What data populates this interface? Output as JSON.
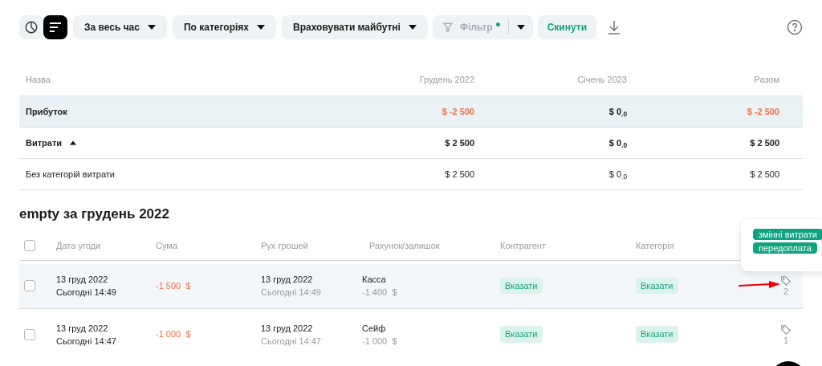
{
  "toolbar": {
    "view_toggles": [
      {
        "kind": "chart",
        "selected": false
      },
      {
        "kind": "list",
        "selected": true
      }
    ],
    "dropdowns": [
      "За весь час",
      "По категоріях",
      "Враховувати майбутні"
    ],
    "filter": {
      "label": "Фільтр",
      "active": true,
      "disabled": true
    },
    "reset": "Скинути"
  },
  "summary": {
    "columns": [
      "Назва",
      "Грудень 2022",
      "Січень 2023",
      "Разом"
    ],
    "rows": [
      {
        "kind": "profit",
        "name": "Прибуток",
        "values": [
          {
            "text": "$ -2 500",
            "negative": true
          },
          {
            "text": "$ 0$_{.0}$",
            "negative": false
          },
          {
            "text": "$ -2 500",
            "negative": true
          }
        ]
      },
      {
        "kind": "group",
        "name": "Витрати",
        "expanded": true,
        "values": [
          {
            "text": "$ 2 500",
            "negative": false
          },
          {
            "text": "$ 0$_{.0}$",
            "negative": false
          },
          {
            "text": "$ 2 500",
            "negative": false
          }
        ]
      },
      {
        "kind": "item",
        "name": "Без категорій витрати",
        "values": [
          {
            "text": "$ 2 500",
            "negative": false
          },
          {
            "text": "$ 0$_{.0}$",
            "negative": false
          },
          {
            "text": "$ 2 500",
            "negative": false
          }
        ]
      }
    ]
  },
  "details": {
    "title": "empty за грудень 2022",
    "columns": [
      "Дата угоди",
      "Сума",
      "Рух грошей",
      "Рахунок/залишок",
      "Контрагент",
      "Категорія"
    ],
    "header_checked": false,
    "rows": [
      {
        "checked": false,
        "highlighted": true,
        "date": "13 груд 2022",
        "date_note": "Сьогодні 14:49",
        "amount": "-1 500  $",
        "flow_date": "13 груд 2022",
        "flow_note": "Сьогодні 14:49",
        "account": "Касса",
        "balance": "-1 400  $",
        "counterparty": "Вказати",
        "category": "Вказати",
        "tag_count": "2"
      },
      {
        "checked": false,
        "highlighted": false,
        "date": "13 груд 2022",
        "date_note": "Сьогодні 14:47",
        "amount": "-1 000  $",
        "flow_date": "13 груд 2022",
        "flow_note": "Сьогодні 14:47",
        "account": "Сейф",
        "balance": "-1 000  $",
        "counterparty": "Вказати",
        "category": "Вказати",
        "tag_count": "1"
      }
    ]
  },
  "tag_popover": {
    "tags": [
      "змінні витрати",
      "передоплата"
    ]
  }
}
